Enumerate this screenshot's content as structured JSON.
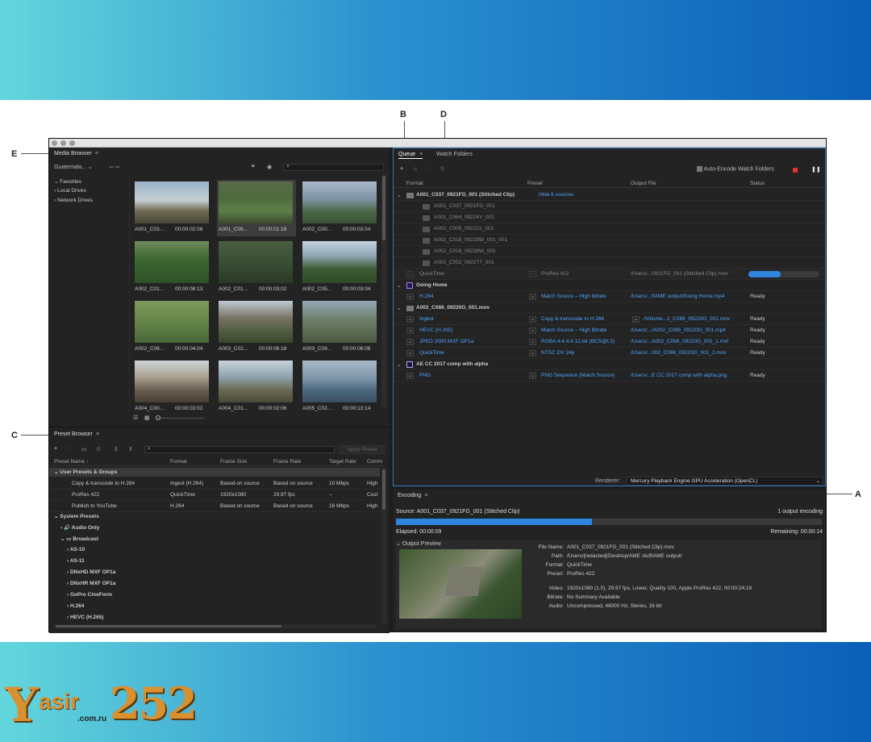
{
  "callouts": {
    "a": "A",
    "b": "B",
    "c": "C",
    "d": "D",
    "e": "E"
  },
  "media_browser": {
    "title": "Media Browser",
    "location": "Guatemala...",
    "tree": [
      "Favorites",
      "Local Drives",
      "Network Drives"
    ],
    "thumbs": [
      {
        "name": "A001_C03...",
        "dur": "00:00:02:08"
      },
      {
        "name": "A001_C06...",
        "dur": "00:00:01:18"
      },
      {
        "name": "A002_C00...",
        "dur": "00:00:03:04"
      },
      {
        "name": "A002_C01...",
        "dur": "00:00:08:13"
      },
      {
        "name": "A002_C01...",
        "dur": "00:00:03:02"
      },
      {
        "name": "A002_C05...",
        "dur": "00:00:03:04"
      },
      {
        "name": "A002_C08...",
        "dur": "00:00:04:04"
      },
      {
        "name": "A003_C02...",
        "dur": "00:00:06:18"
      },
      {
        "name": "A003_C09...",
        "dur": "00:00:06:08"
      },
      {
        "name": "A004_C00...",
        "dur": "00:00:03:02"
      },
      {
        "name": "A004_C01...",
        "dur": "00:00:02:06"
      },
      {
        "name": "A005_C02...",
        "dur": "00:00:13:14"
      }
    ]
  },
  "preset_browser": {
    "title": "Preset Browser",
    "apply": "Apply Preset",
    "cols": [
      "Preset Name",
      "Format",
      "Frame Size",
      "Frame Rate",
      "Target Rate",
      "Comm"
    ],
    "user_group": "User Presets & Groups",
    "user_rows": [
      {
        "name": "Copy & transcode to H.264",
        "format": "Ingest (H.264)",
        "size": "Based on source",
        "rate": "Based on source",
        "target": "10 Mbps",
        "comm": "High"
      },
      {
        "name": "ProRes 422",
        "format": "QuickTime",
        "size": "1920x1080",
        "rate": "29.97 fps",
        "target": "–",
        "comm": "Cust"
      },
      {
        "name": "Publish to YouTube",
        "format": "H.264",
        "size": "Based on source",
        "rate": "Based on source",
        "target": "16 Mbps",
        "comm": "High"
      }
    ],
    "system_group": "System Presets",
    "audio_only": "Audio Only",
    "broadcast": "Broadcast",
    "broadcast_items": [
      "AS-10",
      "AS-11",
      "DNxHD MXF OP1a",
      "DNxHR MXF OP1a",
      "GoPro CineForm",
      "H.264",
      "HEVC (H.265)"
    ]
  },
  "queue": {
    "tab": "Queue",
    "watch_tab": "Watch Folders",
    "auto_encode": "Auto-Encode Watch Folders",
    "cols": [
      "Format",
      "Preset",
      "Output File",
      "Status"
    ],
    "group1": {
      "name": "A001_C037_0921FG_001 (Stitched Clip)",
      "link": "Hide 6 sources",
      "sources": [
        "A001_C037_0921FG_001",
        "A001_C064_09224Y_001",
        "A002_C009_092221_001",
        "A002_C018_09228W_001_001",
        "A002_C018_09228W_001",
        "A002_C052_0922T7_001"
      ],
      "format": "QuickTime",
      "preset": "ProRes 422",
      "output": "/Users/...0921FG_001 (Stitched Clip).mov",
      "progress": 0.45
    },
    "group2": {
      "name": "Going Home",
      "format": "H.264",
      "preset": "Match Source – High bitrate",
      "output": "/Users/...f/AME output/Going Home.mp4",
      "status": "Ready"
    },
    "group3": {
      "name": "A002_C086_09220G_001.mov",
      "rows": [
        {
          "format": "Ingest",
          "preset": "Copy & transcode to H.264",
          "output": "/Volume...2_C086_09220G_001.mov",
          "status": "Ready"
        },
        {
          "format": "HEVC (H.265)",
          "preset": "Match Source – High Bitrate",
          "output": "/Users/.../A002_C086_09220G_001.mp4",
          "status": "Ready"
        },
        {
          "format": "JPEG 2000 MXF OP1a",
          "preset": "RGBA 4:4:4:4 12-bit (BCS@L5)",
          "output": "/Users/...A002_C086_09220G_001_1.mxf",
          "status": "Ready"
        },
        {
          "format": "QuickTime",
          "preset": "NTSC DV 24p",
          "output": "/Users/...002_C086_09220G_001_2.mov",
          "status": "Ready"
        }
      ]
    },
    "group4": {
      "name": "AE CC 2017 comp with alpha",
      "format": "PNG",
      "preset": "PNG Sequence (Match Source)",
      "output": "/Users/...E CC 2017 comp with alpha.png",
      "status": "Ready"
    },
    "renderer_label": "Renderer:",
    "renderer": "Mercury Playback Engine GPU Acceleration (OpenCL)"
  },
  "encoding": {
    "title": "Encoding",
    "source": "Source: A001_C037_0921FG_001 (Stitched Clip)",
    "count": "1 output encoding",
    "progress": 0.46,
    "elapsed": "Elapsed: 00:00:09",
    "remaining": "Remaining: 00:00:14",
    "preview": "Output Preview",
    "info": [
      {
        "k": "File Name:",
        "v": "A001_C037_0921FG_001 (Stitched Clip).mov"
      },
      {
        "k": "Path:",
        "v": "/Users/[redacted]/Desktop/AME stuff/AME output/"
      },
      {
        "k": "Format:",
        "v": "QuickTime"
      },
      {
        "k": "Preset:",
        "v": "ProRes 422"
      },
      {
        "k": "Video:",
        "v": "1920x1080 (1.0), 29.97 fps, Lower, Quality 100, Apple ProRes 422, 00:00:24:19"
      },
      {
        "k": "Bitrate:",
        "v": "No Summary Available"
      },
      {
        "k": "Audio:",
        "v": "Uncompressed, 48000 Hz, Stereo, 16 bit"
      }
    ]
  },
  "watermark": {
    "brand": "Yasir",
    "num": "252",
    "domain": ".com.ru"
  }
}
